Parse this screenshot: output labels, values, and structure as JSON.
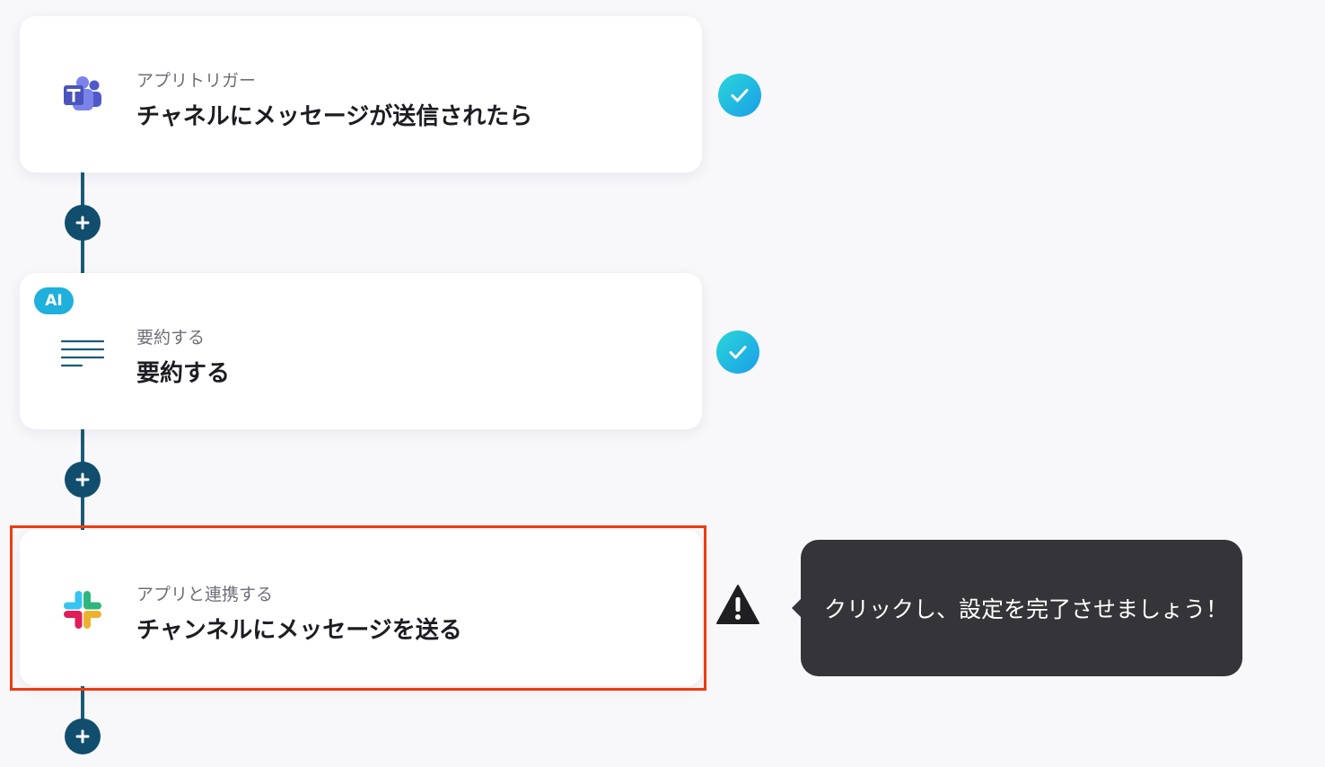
{
  "flow": {
    "steps": [
      {
        "subtitle": "アプリトリガー",
        "title": "チャネルにメッセージが送信されたら",
        "icon": "microsoft-teams-icon",
        "status": "complete"
      },
      {
        "badge": "AI",
        "subtitle": "要約する",
        "title": "要約する",
        "icon": "summarize-lines-icon",
        "status": "complete"
      },
      {
        "subtitle": "アプリと連携する",
        "title": "チャンネルにメッセージを送る",
        "icon": "slack-icon",
        "status": "warning",
        "highlighted": true
      }
    ],
    "tooltip": "クリックし、設定を完了させましょう！"
  },
  "colors": {
    "background": "#f8f7fa",
    "connector": "#114e6d",
    "check_gradient_start": "#2ad7d8",
    "check_gradient_end": "#1a9ee8",
    "highlight_border": "#ef3b12",
    "tooltip_background": "#353438",
    "ai_badge": "#1fb0dc"
  }
}
